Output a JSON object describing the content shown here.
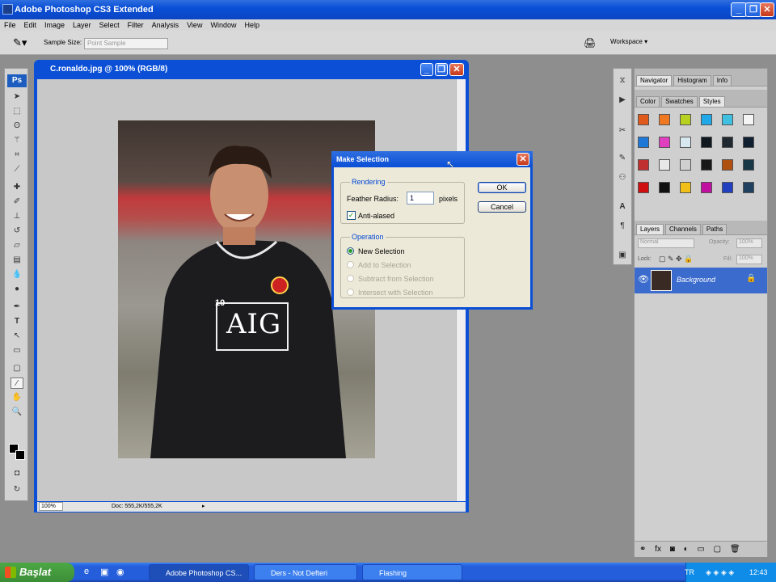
{
  "window": {
    "title": "Adobe Photoshop CS3 Extended"
  },
  "menu": [
    "File",
    "Edit",
    "Image",
    "Layer",
    "Select",
    "Filter",
    "Analysis",
    "View",
    "Window",
    "Help"
  ],
  "options": {
    "sample_size_label": "Sample Size:",
    "sample_size_value": "Point Sample",
    "workspace_label": "Workspace ▾"
  },
  "toolbox": {
    "badge": "Ps"
  },
  "document": {
    "title": "C.ronaldo.jpg @ 100% (RGB/8)",
    "zoom": "100%",
    "doc_info": "Doc: 555,2K/555,2K"
  },
  "dialog": {
    "title": "Make Selection",
    "rendering_group": "Rendering",
    "feather_label": "Feather Radius:",
    "feather_value": "1",
    "feather_unit": "pixels",
    "antialiased_label": "Anti-alased",
    "operation_group": "Operation",
    "op_new": "New Selection",
    "op_add": "Add to Selection",
    "op_subtract": "Subtract from Selection",
    "op_intersect": "Intersect with Selection",
    "ok": "OK",
    "cancel": "Cancel"
  },
  "panels": {
    "top_tabs": [
      "Navigator",
      "Histogram",
      "Info"
    ],
    "mid_tabs": [
      "Color",
      "Swatches",
      "Styles"
    ],
    "layer_tabs": [
      "Layers",
      "Channels",
      "Paths"
    ],
    "blend_mode": "Normal",
    "opacity_label": "Opacity:",
    "opacity_value": "100%",
    "lock_label": "Lock:",
    "fill_label": "Fill:",
    "fill_value": "100%",
    "layer_name": "Background"
  },
  "styles_colors": [
    "#e05a1c",
    "#f07820",
    "#b8d020",
    "#20a8e8",
    "#40c0e0",
    "#f4f4f4",
    "#1e78d8",
    "#e040c0",
    "#d8e8f0",
    "#101820",
    "#202830",
    "#102030",
    "#c03030",
    "#e8e8e8",
    "#d0d0d0",
    "#181818",
    "#b05010",
    "#183848",
    "#d01010",
    "#101010",
    "#f0c018",
    "#c010a0",
    "#2040c0",
    "#204060"
  ],
  "taskbar": {
    "start": "Başlat",
    "tasks": [
      "Adobe Photoshop CS...",
      "Ders - Not Defteri",
      "Flashing"
    ],
    "lang": "TR",
    "clock": "12:43"
  },
  "photo": {
    "jersey_text": "AIG",
    "number": "10"
  }
}
